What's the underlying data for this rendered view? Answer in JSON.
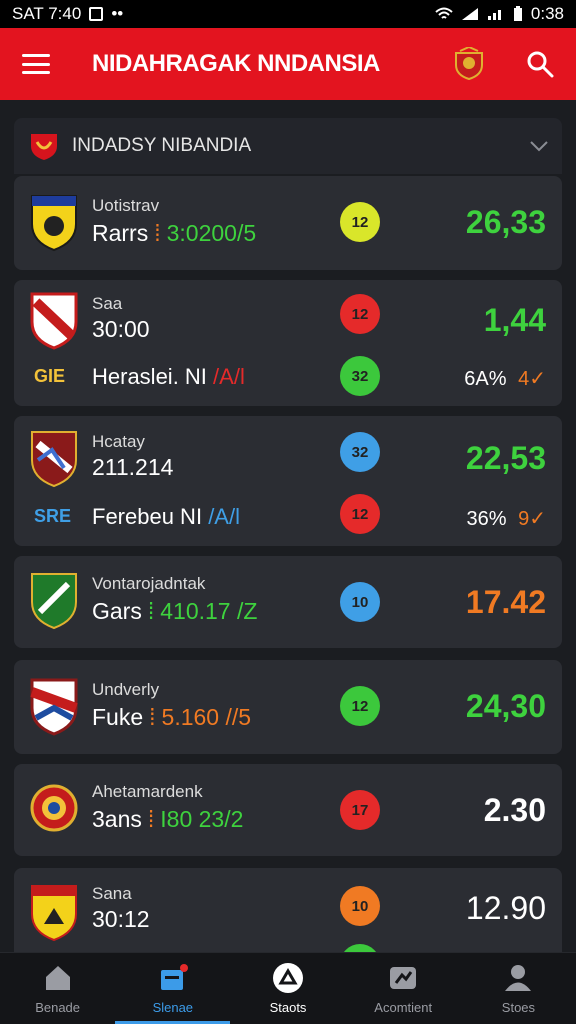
{
  "status_bar": {
    "time_left": "SAT 7:40",
    "time_right": "0:38"
  },
  "app_bar": {
    "title": "NIDAHRAGAK NNDANSIA"
  },
  "group": {
    "name": "INDADSY NIBANDIA"
  },
  "colors": {
    "brand_red": "#e3141f",
    "green": "#3ed23e",
    "orange": "#f07a23",
    "yellow_chip": "#d9e62a",
    "red_chip": "#e52a2a",
    "green_chip": "#3cc83c",
    "blue_chip": "#3f9fe6",
    "orange_chip": "#f07a23"
  },
  "matches": [
    {
      "top": "Uotistrav",
      "main": "Rarrs",
      "accent": "3:0200/5",
      "chip": "12",
      "odds": "26,33"
    },
    {
      "top": "Saa",
      "main": "30:00",
      "chip": "12",
      "odds": "1,44",
      "sub_abbr": "GIE",
      "sub_name": "Heraslei. NI",
      "sub_accent": "/A/l",
      "sub_chip": "32",
      "sub_pct": "6A% ",
      "sub_arrow": "4✓"
    },
    {
      "top": "Hcatay",
      "main": "211.214",
      "chip": "32",
      "odds": "22,53",
      "sub_abbr": "SRE",
      "sub_name": "Ferebeu NI",
      "sub_accent": "/A/l",
      "sub_chip": "12",
      "sub_pct": "36% ",
      "sub_arrow": "9✓"
    },
    {
      "top": "Vontarojadntak",
      "main": "Gars",
      "accent": "410.17 /Z",
      "chip": "10",
      "odds": "17.42"
    },
    {
      "top": "Undverly",
      "main": "Fuke",
      "accent": "5.160 //5",
      "chip": "12",
      "odds": "24,30"
    },
    {
      "top": "Ahetamardenk",
      "main": "3ans",
      "accent": "I80 23/2",
      "chip": "17",
      "odds": "2.30"
    },
    {
      "top": "Sana",
      "main": "30:12",
      "chip": "10",
      "odds": "12.90"
    }
  ],
  "nav": [
    {
      "label": "Benade",
      "icon": "home-icon"
    },
    {
      "label": "Slenae",
      "icon": "news-icon"
    },
    {
      "label": "Staots",
      "icon": "bet-icon"
    },
    {
      "label": "Acomtient",
      "icon": "chart-icon"
    },
    {
      "label": "Stoes",
      "icon": "profile-icon"
    }
  ]
}
